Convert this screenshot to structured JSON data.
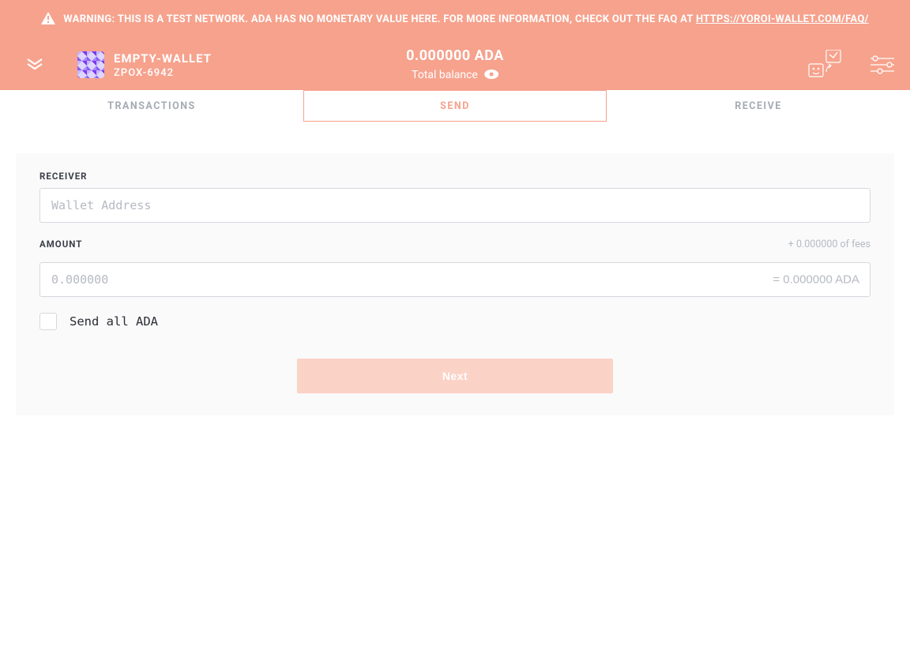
{
  "warning": {
    "text_prefix": "WARNING: THIS IS A TEST NETWORK. ADA HAS NO MONETARY VALUE HERE. FOR MORE INFORMATION, CHECK OUT THE FAQ AT ",
    "link_text": "HTTPS://YOROI-WALLET.COM/FAQ/"
  },
  "header": {
    "wallet_name": "EMPTY-WALLET",
    "wallet_sub": "ZPOX-6942",
    "balance_amount": "0.000000 ADA",
    "balance_label": "Total balance"
  },
  "tabs": {
    "transactions": "TRANSACTIONS",
    "send": "SEND",
    "receive": "RECEIVE"
  },
  "form": {
    "receiver_label": "RECEIVER",
    "receiver_placeholder": "Wallet Address",
    "receiver_value": "",
    "amount_label": "AMOUNT",
    "fees_hint": "+ 0.000000 of fees",
    "amount_placeholder": "0.000000",
    "amount_value": "",
    "amount_equals": "= 0.000000 ADA",
    "send_all_label": "Send all ADA",
    "next_label": "Next"
  },
  "colors": {
    "brand": "#f6a28d",
    "muted": "#b6bac2"
  }
}
